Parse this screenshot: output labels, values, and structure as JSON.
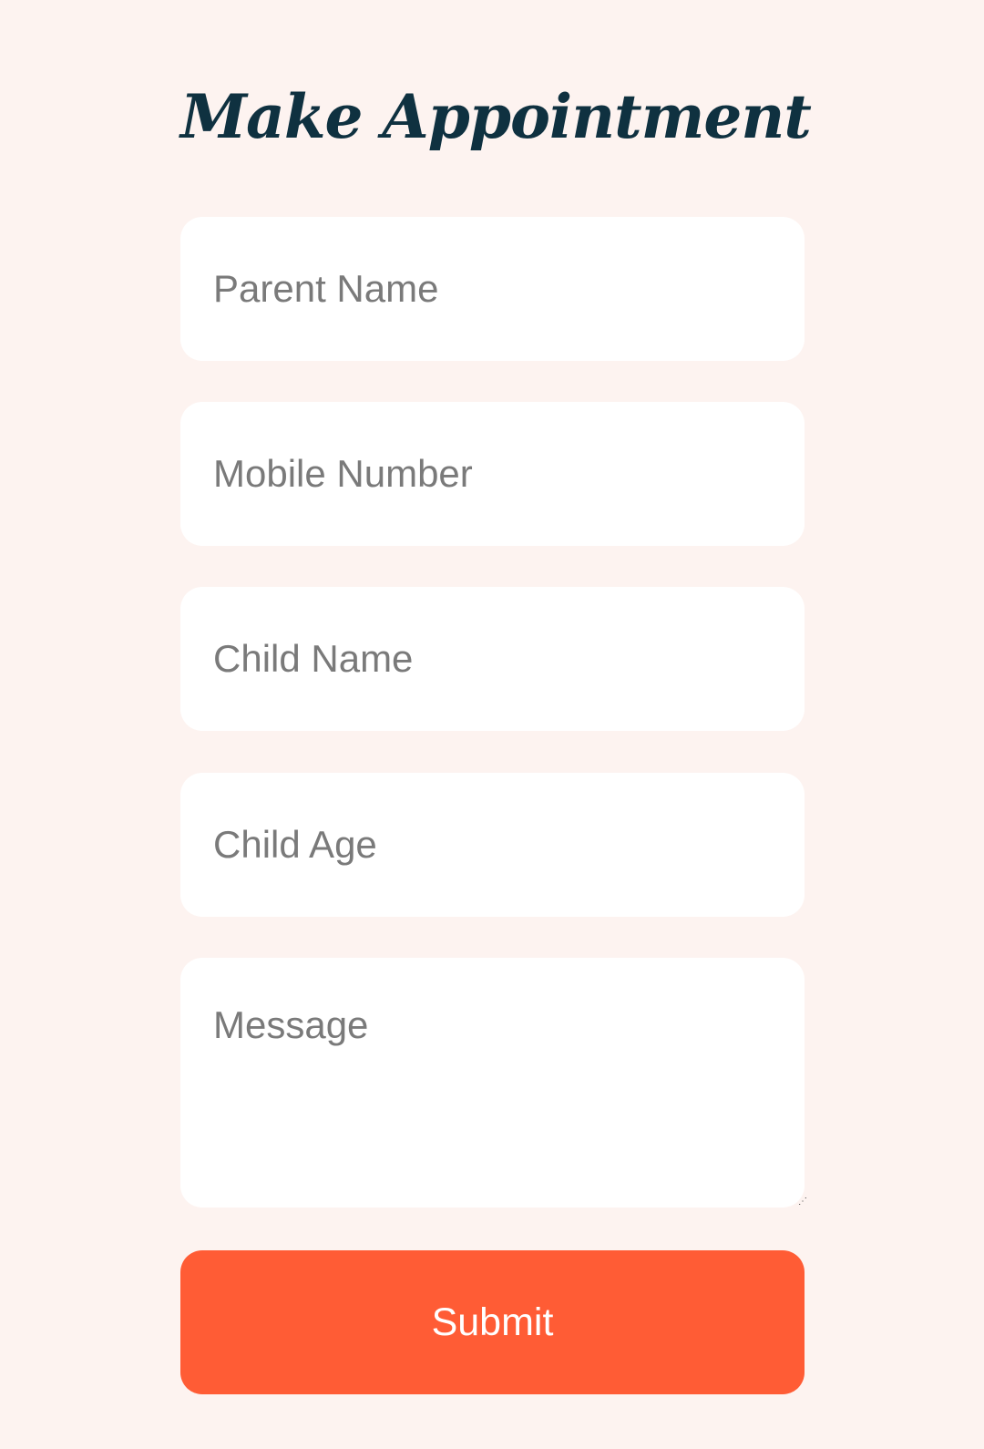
{
  "form": {
    "title": "Make Appointment",
    "fields": {
      "parent_name": {
        "placeholder": "Parent Name",
        "value": ""
      },
      "mobile_number": {
        "placeholder": "Mobile Number",
        "value": ""
      },
      "child_name": {
        "placeholder": "Child Name",
        "value": ""
      },
      "child_age": {
        "placeholder": "Child Age",
        "value": ""
      },
      "message": {
        "placeholder": "Message",
        "value": ""
      }
    },
    "submit_label": "Submit"
  },
  "colors": {
    "background": "#fdf3f0",
    "title": "#0f3140",
    "field_background": "#ffffff",
    "placeholder": "#7a7a7a",
    "accent": "#ff5c35"
  }
}
